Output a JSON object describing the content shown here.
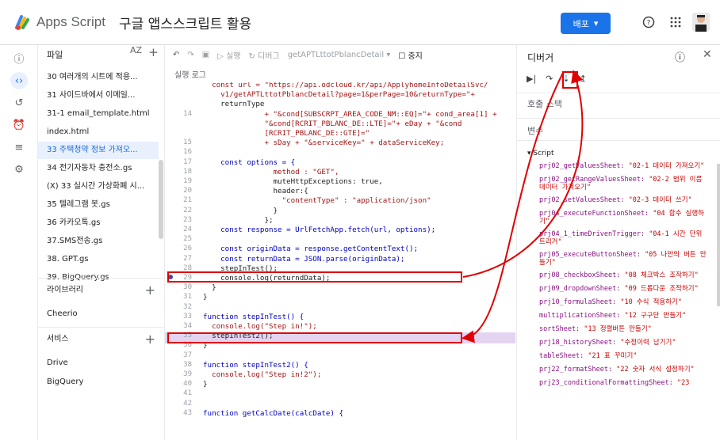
{
  "header": {
    "app_name": "Apps Script",
    "project_title": "구글 앱스스크립트 활용",
    "deploy_label": "배포",
    "help_icon": "help-icon",
    "apps_icon": "apps-grid-icon"
  },
  "rail": [
    "info-icon",
    "code-icon",
    "history-icon",
    "trigger-icon",
    "executions-icon",
    "settings-icon"
  ],
  "files": {
    "title": "파일",
    "sort_label": "AZ",
    "items": [
      "30 여러개의 시트에 적용...",
      "31 사이드바에서 이메일...",
      "31-1 email_template.html",
      "index.html",
      "33 주택청약 정보 가져오...",
      "34 전기자동차 충전소.gs",
      "(X) 33 실시간 가상화폐 시...",
      "35 텔레그램 봇.gs",
      "36 카카오톡.gs",
      "37.SMS전송.gs",
      "38. GPT.gs",
      "39. BigQuery.gs"
    ],
    "selected_index": 4
  },
  "libraries": {
    "title": "라이브러리",
    "items": [
      "Cheerio"
    ]
  },
  "services": {
    "title": "서비스",
    "items": [
      "Drive",
      "BigQuery"
    ]
  },
  "toolbar": {
    "run": "실행",
    "debug": "디버그",
    "function": "getAPTLttotPblancDetail",
    "stop": "중지"
  },
  "exec_log": "실행 로그",
  "code": {
    "lines": [
      {
        "n": "",
        "t": "  const url = \"https://api.odcloud.kr/api/ApplyhomeInfoDetailSvc/"
      },
      {
        "n": "",
        "t": "    v1/getAPTLttotPblancDetail?page=1&perPage=10&returnType=\"+"
      },
      {
        "n": "",
        "t": "    returnType"
      },
      {
        "n": "14",
        "t": "              + \"&cond[SUBSCRPT_AREA_CODE_NM::EQ]=\"+ cond_area[1] +"
      },
      {
        "n": "",
        "t": "              \"&cond[RCRIT_PBLANC_DE::LTE]=\"+ eDay + \"&cond"
      },
      {
        "n": "",
        "t": "              [RCRIT_PBLANC_DE::GTE]=\""
      },
      {
        "n": "15",
        "t": "              + sDay + \"&serviceKey=\" + dataServiceKey;"
      },
      {
        "n": "16",
        "t": ""
      },
      {
        "n": "17",
        "t": "    const options = {"
      },
      {
        "n": "18",
        "t": "                method : \"GET\","
      },
      {
        "n": "19",
        "t": "                muteHttpExceptions: true,"
      },
      {
        "n": "20",
        "t": "                header:{"
      },
      {
        "n": "21",
        "t": "                  \"contentType\" : \"application/json\""
      },
      {
        "n": "22",
        "t": "                }"
      },
      {
        "n": "23",
        "t": "              };"
      },
      {
        "n": "24",
        "t": "    const response = UrlFetchApp.fetch(url, options);"
      },
      {
        "n": "25",
        "t": ""
      },
      {
        "n": "26",
        "t": "    const originData = response.getContentText();"
      },
      {
        "n": "27",
        "t": "    const returnData = JSON.parse(originData);"
      },
      {
        "n": "28",
        "t": "    stepInTest();"
      },
      {
        "n": "29",
        "t": "    console.log(returndData);"
      },
      {
        "n": "30",
        "t": "  }"
      },
      {
        "n": "31",
        "t": "}"
      },
      {
        "n": "32",
        "t": ""
      },
      {
        "n": "33",
        "t": "function stepInTest() {"
      },
      {
        "n": "34",
        "t": "  console.log(\"Step in!\");"
      },
      {
        "n": "35",
        "t": "  stepInTest2();"
      },
      {
        "n": "36",
        "t": "}"
      },
      {
        "n": "37",
        "t": ""
      },
      {
        "n": "38",
        "t": "function stepInTest2() {"
      },
      {
        "n": "39",
        "t": "  console.log(\"Step in!2\");"
      },
      {
        "n": "40",
        "t": "}"
      },
      {
        "n": "41",
        "t": ""
      },
      {
        "n": "42",
        "t": ""
      },
      {
        "n": "43",
        "t": "function getCalcDate(calcDate) {"
      }
    ]
  },
  "debugger": {
    "title": "디버거",
    "call_stack": "호출 스택",
    "variables": "변수",
    "script": "Script",
    "vars": [
      {
        "k": "prj02_getValuesSheet:",
        "v": "\"02-1 데이터 가져오기\""
      },
      {
        "k": "prj02_getRangeValuesSheet:",
        "v": "\"02-2 범위 이름 데이터 가져오기\""
      },
      {
        "k": "prj02_setValuesSheet:",
        "v": "\"02-3 데이터 쓰기\""
      },
      {
        "k": "prj04_executeFunctionSheet:",
        "v": "\"04 함수 실행하기\""
      },
      {
        "k": "prj04_1_timeDrivenTrigger:",
        "v": "\"04-1 시간 단위 트리거\""
      },
      {
        "k": "prj05_executeButtonSheet:",
        "v": "\"05 나만의 버튼 만들기\""
      },
      {
        "k": "prj08_checkboxSheet:",
        "v": "\"08 체크박스 조작하기\""
      },
      {
        "k": "prj09_dropdownSheet:",
        "v": "\"09 드롭다운 조작하기\""
      },
      {
        "k": "prj10_formulaSheet:",
        "v": "\"10 수식 적용하기\""
      },
      {
        "k": "multiplicationSheet:",
        "v": "\"12 구구단 만들기\""
      },
      {
        "k": "sortSheet:",
        "v": "\"13 정렬버튼 만들기\""
      },
      {
        "k": "prj18_historySheet:",
        "v": "\"수정이력 남기기\""
      },
      {
        "k": "tableSheet:",
        "v": "\"21 표 꾸미기\""
      },
      {
        "k": "prj22_formatSheet:",
        "v": "\"22 숫자 서식 설정하기\""
      },
      {
        "k": "prj23_conditionalFormattingSheet:",
        "v": "\"23"
      }
    ]
  }
}
